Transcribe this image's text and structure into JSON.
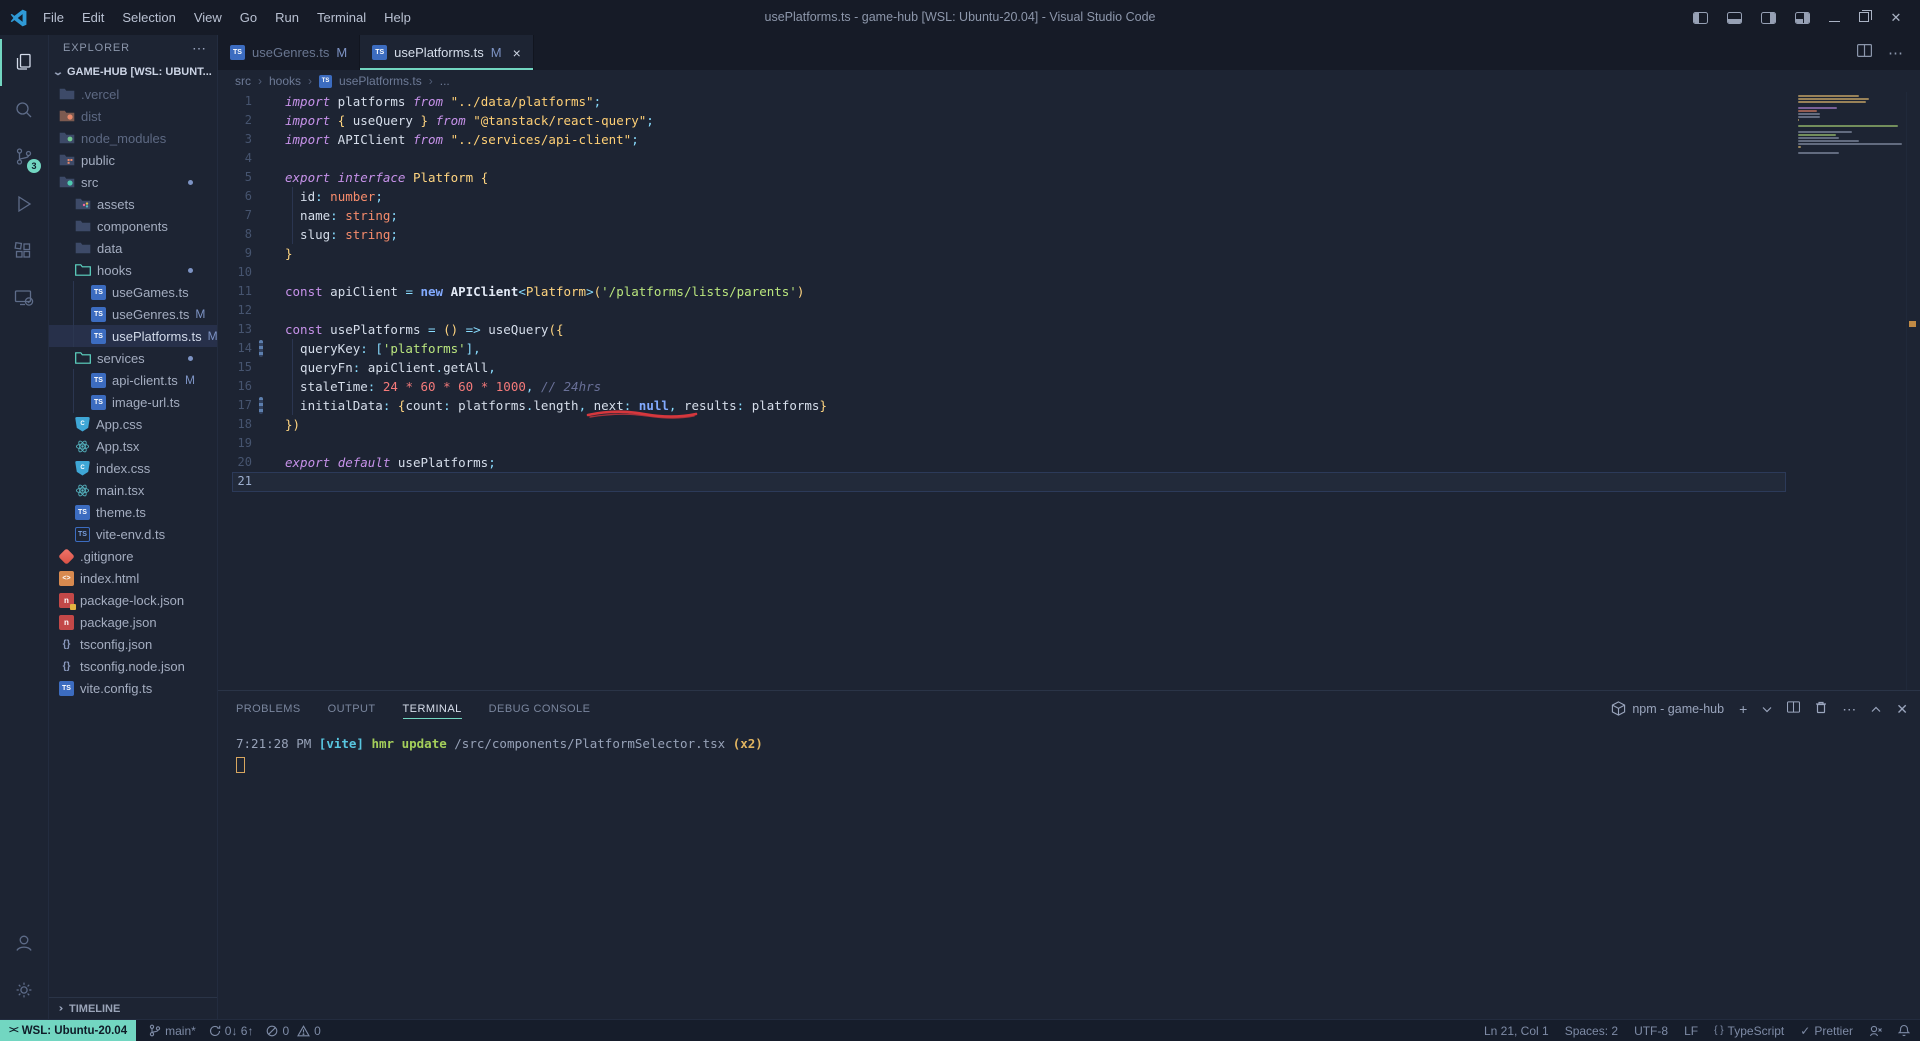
{
  "title_bar": {
    "menus": [
      "File",
      "Edit",
      "Selection",
      "View",
      "Go",
      "Run",
      "Terminal",
      "Help"
    ],
    "title": "usePlatforms.ts - game-hub [WSL: Ubuntu-20.04] - Visual Studio Code"
  },
  "activity_bar": {
    "items": [
      "explorer",
      "search",
      "source-control",
      "run-and-debug",
      "extensions",
      "remote-explorer"
    ],
    "active": "explorer",
    "source_control_badge": "3",
    "bottom": [
      "accounts",
      "manage"
    ]
  },
  "sidebar": {
    "header": "EXPLORER",
    "more_actions": "⋯",
    "section": "GAME-HUB [WSL: UBUNT...",
    "timeline": "TIMELINE",
    "tree": [
      {
        "label": ".vercel",
        "kind": "folder",
        "style": "plain",
        "depth": 0,
        "dim": true
      },
      {
        "label": "dist",
        "kind": "folder",
        "style": "dist",
        "depth": 0,
        "dim": true
      },
      {
        "label": "node_modules",
        "kind": "folder",
        "style": "node",
        "depth": 0,
        "dim": true
      },
      {
        "label": "public",
        "kind": "folder",
        "style": "public",
        "depth": 0
      },
      {
        "label": "src",
        "kind": "folder",
        "style": "src",
        "depth": 0,
        "badge": "dot"
      },
      {
        "label": "assets",
        "kind": "folder",
        "style": "assets",
        "depth": 1
      },
      {
        "label": "components",
        "kind": "folder",
        "style": "plain",
        "depth": 1
      },
      {
        "label": "data",
        "kind": "folder",
        "style": "plain",
        "depth": 1
      },
      {
        "label": "hooks",
        "kind": "folder",
        "style": "open",
        "depth": 1,
        "badge": "dot"
      },
      {
        "label": "useGames.ts",
        "kind": "file",
        "icon": "ts",
        "depth": 2
      },
      {
        "label": "useGenres.ts",
        "kind": "file",
        "icon": "ts",
        "depth": 2,
        "badge": "M"
      },
      {
        "label": "usePlatforms.ts",
        "kind": "file",
        "icon": "ts",
        "depth": 2,
        "badge": "M",
        "selected": true
      },
      {
        "label": "services",
        "kind": "folder",
        "style": "open",
        "depth": 1,
        "badge": "dot"
      },
      {
        "label": "api-client.ts",
        "kind": "file",
        "icon": "ts",
        "depth": 2,
        "badge": "M"
      },
      {
        "label": "image-url.ts",
        "kind": "file",
        "icon": "ts",
        "depth": 2
      },
      {
        "label": "App.css",
        "kind": "file",
        "icon": "css",
        "depth": 1
      },
      {
        "label": "App.tsx",
        "kind": "file",
        "icon": "react",
        "depth": 1
      },
      {
        "label": "index.css",
        "kind": "file",
        "icon": "css",
        "depth": 1
      },
      {
        "label": "main.tsx",
        "kind": "file",
        "icon": "react",
        "depth": 1
      },
      {
        "label": "theme.ts",
        "kind": "file",
        "icon": "ts",
        "depth": 1
      },
      {
        "label": "vite-env.d.ts",
        "kind": "file",
        "icon": "tsd",
        "depth": 1
      },
      {
        "label": ".gitignore",
        "kind": "file",
        "icon": "git",
        "depth": 0
      },
      {
        "label": "index.html",
        "kind": "file",
        "icon": "html",
        "depth": 0
      },
      {
        "label": "package-lock.json",
        "kind": "file",
        "icon": "npmlock",
        "depth": 0
      },
      {
        "label": "package.json",
        "kind": "file",
        "icon": "npm",
        "depth": 0
      },
      {
        "label": "tsconfig.json",
        "kind": "file",
        "icon": "brc",
        "depth": 0
      },
      {
        "label": "tsconfig.node.json",
        "kind": "file",
        "icon": "brc",
        "depth": 0
      },
      {
        "label": "vite.config.ts",
        "kind": "file",
        "icon": "ts",
        "depth": 0
      }
    ]
  },
  "tabs": [
    {
      "label": "useGenres.ts",
      "badge": "M",
      "active": false
    },
    {
      "label": "usePlatforms.ts",
      "badge": "M",
      "active": true,
      "close": "×"
    }
  ],
  "breadcrumb": {
    "items": [
      {
        "label": "src"
      },
      {
        "label": "hooks"
      },
      {
        "label": "usePlatforms.ts",
        "icon": "ts"
      },
      {
        "label": "..."
      }
    ]
  },
  "editor": {
    "current_line": 21,
    "git_modified_lines": [
      14,
      17
    ],
    "annotation": {
      "type": "hand-drawn-underline",
      "under_text": "next: null,",
      "line": 17,
      "color": "#e0393e"
    },
    "lines": [
      {
        "n": 1,
        "tokens": [
          [
            "import",
            "k"
          ],
          [
            " platforms ",
            "i"
          ],
          [
            "from",
            "k"
          ],
          [
            " ",
            "i"
          ],
          [
            "\"../data/platforms\"",
            "s"
          ],
          [
            ";",
            "o"
          ]
        ]
      },
      {
        "n": 2,
        "tokens": [
          [
            "import",
            "k"
          ],
          [
            " ",
            "i"
          ],
          [
            "{ ",
            "B"
          ],
          [
            "useQuery",
            "i"
          ],
          [
            " }",
            "B"
          ],
          [
            " ",
            "i"
          ],
          [
            "from",
            "k"
          ],
          [
            " ",
            "i"
          ],
          [
            "\"@tanstack/react-query\"",
            "s"
          ],
          [
            ";",
            "o"
          ]
        ]
      },
      {
        "n": 3,
        "tokens": [
          [
            "import",
            "k"
          ],
          [
            " APIClient ",
            "i"
          ],
          [
            "from",
            "k"
          ],
          [
            " ",
            "i"
          ],
          [
            "\"../services/api-client\"",
            "s"
          ],
          [
            ";",
            "o"
          ]
        ]
      },
      {
        "n": 4,
        "tokens": []
      },
      {
        "n": 5,
        "tokens": [
          [
            "export",
            "k"
          ],
          [
            " ",
            "i"
          ],
          [
            "interface",
            "k"
          ],
          [
            " ",
            "i"
          ],
          [
            "Platform",
            "t"
          ],
          [
            " ",
            "i"
          ],
          [
            "{",
            "B"
          ]
        ]
      },
      {
        "n": 6,
        "tokens": [
          [
            "  id",
            "i"
          ],
          [
            ": ",
            "o"
          ],
          [
            "number",
            "p"
          ],
          [
            ";",
            "o"
          ]
        ],
        "guide": true
      },
      {
        "n": 7,
        "tokens": [
          [
            "  name",
            "i"
          ],
          [
            ": ",
            "o"
          ],
          [
            "string",
            "p"
          ],
          [
            ";",
            "o"
          ]
        ],
        "guide": true
      },
      {
        "n": 8,
        "tokens": [
          [
            "  slug",
            "i"
          ],
          [
            ": ",
            "o"
          ],
          [
            "string",
            "p"
          ],
          [
            ";",
            "o"
          ]
        ],
        "guide": true
      },
      {
        "n": 9,
        "tokens": [
          [
            "}",
            "B"
          ]
        ]
      },
      {
        "n": 10,
        "tokens": []
      },
      {
        "n": 11,
        "tokens": [
          [
            "const",
            "K"
          ],
          [
            " apiClient ",
            "i"
          ],
          [
            "= ",
            "o"
          ],
          [
            "new",
            "b"
          ],
          [
            " ",
            "i"
          ],
          [
            "APIClient",
            "F"
          ],
          [
            "<",
            "o"
          ],
          [
            "Platform",
            "t"
          ],
          [
            ">",
            "o"
          ],
          [
            "(",
            "B"
          ],
          [
            "'/platforms/lists/parents'",
            "g"
          ],
          [
            ")",
            "B"
          ]
        ]
      },
      {
        "n": 12,
        "tokens": []
      },
      {
        "n": 13,
        "tokens": [
          [
            "const",
            "K"
          ],
          [
            " usePlatforms ",
            "i"
          ],
          [
            "= ",
            "o"
          ],
          [
            "()",
            "B"
          ],
          [
            " ",
            "i"
          ],
          [
            "=> ",
            "o"
          ],
          [
            "useQuery",
            "i"
          ],
          [
            "({",
            "B"
          ]
        ]
      },
      {
        "n": 14,
        "tokens": [
          [
            "  queryKey",
            "i"
          ],
          [
            ": ",
            "o"
          ],
          [
            "[",
            "o"
          ],
          [
            "'platforms'",
            "g"
          ],
          [
            "],",
            "o"
          ]
        ],
        "guide": true,
        "mark": true
      },
      {
        "n": 15,
        "tokens": [
          [
            "  queryFn",
            "i"
          ],
          [
            ": ",
            "o"
          ],
          [
            "apiClient",
            "i"
          ],
          [
            ".",
            "o"
          ],
          [
            "getAll",
            "i"
          ],
          [
            ",",
            "o"
          ]
        ],
        "guide": true
      },
      {
        "n": 16,
        "tokens": [
          [
            "  staleTime",
            "i"
          ],
          [
            ": ",
            "o"
          ],
          [
            "24",
            "n"
          ],
          [
            " * ",
            "n"
          ],
          [
            "60",
            "n"
          ],
          [
            " * ",
            "n"
          ],
          [
            "60",
            "n"
          ],
          [
            " * ",
            "n"
          ],
          [
            "1000",
            "n"
          ],
          [
            ", ",
            "o"
          ],
          [
            "// 24hrs",
            "c"
          ]
        ],
        "guide": true
      },
      {
        "n": 17,
        "tokens": [
          [
            "  initialData",
            "i"
          ],
          [
            ": ",
            "o"
          ],
          [
            "{",
            "B"
          ],
          [
            "count",
            "i"
          ],
          [
            ": ",
            "o"
          ],
          [
            "platforms",
            "i"
          ],
          [
            ".",
            "o"
          ],
          [
            "length",
            "i"
          ],
          [
            ", ",
            "o"
          ],
          [
            "next",
            "i"
          ],
          [
            ": ",
            "o"
          ],
          [
            "null",
            "b"
          ],
          [
            ", ",
            "o"
          ],
          [
            "results",
            "i"
          ],
          [
            ": ",
            "o"
          ],
          [
            "platforms",
            "i"
          ],
          [
            "}",
            "B"
          ]
        ],
        "guide": true,
        "mark": true
      },
      {
        "n": 18,
        "tokens": [
          [
            "})",
            "B"
          ]
        ]
      },
      {
        "n": 19,
        "tokens": []
      },
      {
        "n": 20,
        "tokens": [
          [
            "export",
            "k"
          ],
          [
            " ",
            "i"
          ],
          [
            "default",
            "k"
          ],
          [
            " usePlatforms",
            "i"
          ],
          [
            ";",
            "o"
          ]
        ]
      },
      {
        "n": 21,
        "tokens": [],
        "current": true
      }
    ]
  },
  "editor_actions": [
    "split-editor",
    "more-actions"
  ],
  "panel": {
    "tabs": [
      "PROBLEMS",
      "OUTPUT",
      "TERMINAL",
      "DEBUG CONSOLE"
    ],
    "active": "TERMINAL",
    "terminal_label": "npm - game-hub",
    "output_line": [
      [
        "7:21:28 PM ",
        "dim"
      ],
      [
        "[vite]",
        "cyan"
      ],
      [
        " ",
        "dim"
      ],
      [
        "hmr update ",
        "green"
      ],
      [
        "/src/components/PlatformSelector.tsx ",
        "dim"
      ],
      [
        "(x2)",
        "yellow"
      ]
    ]
  },
  "status_bar": {
    "remote": "WSL: Ubuntu-20.04",
    "branch": "main*",
    "sync": "0↓ 6↑",
    "errors": "0",
    "warnings": "0",
    "line_col": "Ln 21, Col 1",
    "indent": "Spaces: 2",
    "encoding": "UTF-8",
    "eol": "LF",
    "language": "TypeScript",
    "formatter_check": "✓",
    "formatter": "Prettier"
  },
  "colors": {
    "accent_teal": "#72d6c1",
    "editor_bg": "#1d2433",
    "chrome_bg": "#161b27",
    "annotation_red": "#e0393e"
  }
}
